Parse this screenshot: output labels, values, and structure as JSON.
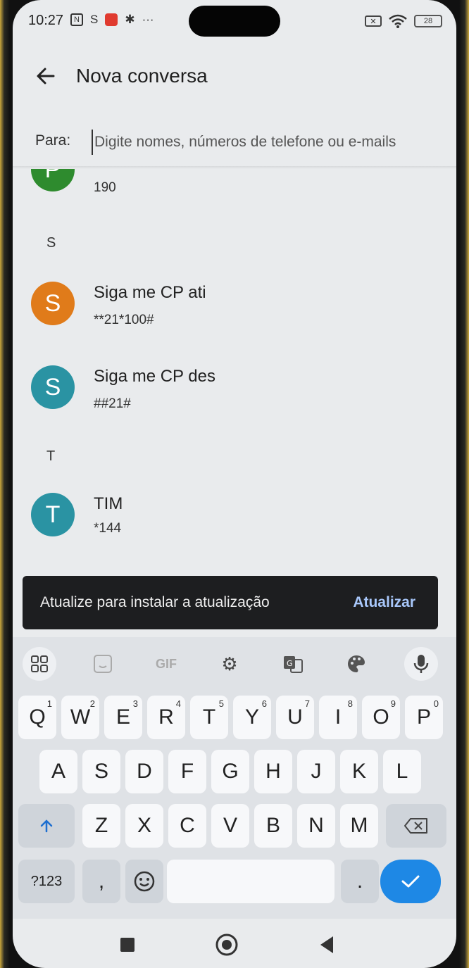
{
  "status": {
    "time": "10:27",
    "battery": "28",
    "more": "···"
  },
  "header": {
    "title": "Nova conversa"
  },
  "to": {
    "label": "Para:",
    "placeholder": "Digite nomes, números de telefone ou e-mails"
  },
  "contacts": {
    "partial": {
      "initial": "P",
      "number": "190",
      "color": "#2e8b2e"
    },
    "section_s": "S",
    "items_s": [
      {
        "initial": "S",
        "name": "Siga me CP ati",
        "number": "**21*100#",
        "color": "#e07b1a"
      },
      {
        "initial": "S",
        "name": "Siga me CP des",
        "number": "##21#",
        "color": "#2a93a3"
      }
    ],
    "section_t": "T",
    "items_t": [
      {
        "initial": "T",
        "name": "TIM",
        "number": "*144",
        "color": "#2a93a3"
      }
    ]
  },
  "snackbar": {
    "message": "Atualize para instalar a atualização",
    "action": "Atualizar"
  },
  "keyboard": {
    "toolbar": {
      "gif": "GIF"
    },
    "row1": [
      {
        "k": "Q",
        "h": "1"
      },
      {
        "k": "W",
        "h": "2"
      },
      {
        "k": "E",
        "h": "3"
      },
      {
        "k": "R",
        "h": "4"
      },
      {
        "k": "T",
        "h": "5"
      },
      {
        "k": "Y",
        "h": "6"
      },
      {
        "k": "U",
        "h": "7"
      },
      {
        "k": "I",
        "h": "8"
      },
      {
        "k": "O",
        "h": "9"
      },
      {
        "k": "P",
        "h": "0"
      }
    ],
    "row2": [
      "A",
      "S",
      "D",
      "F",
      "G",
      "H",
      "J",
      "K",
      "L"
    ],
    "row3": [
      "Z",
      "X",
      "C",
      "V",
      "B",
      "N",
      "M"
    ],
    "symbols": "?123",
    "comma": ",",
    "period": "."
  }
}
